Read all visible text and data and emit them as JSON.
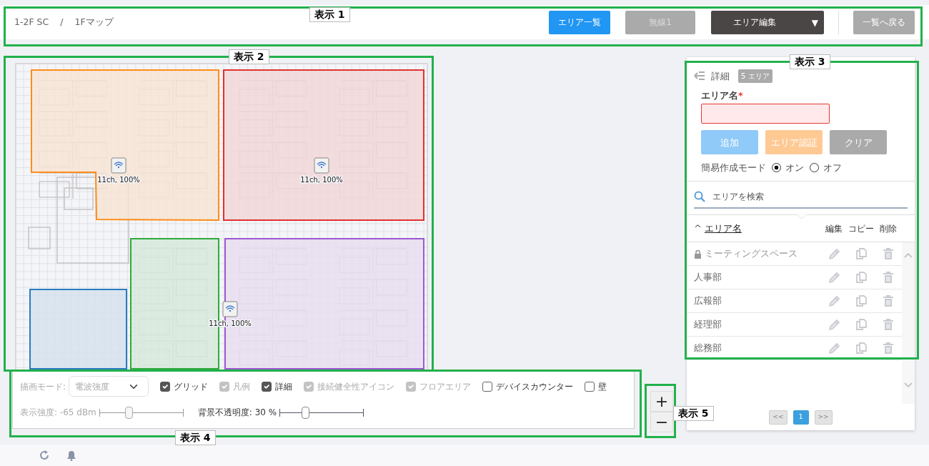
{
  "breadcrumb": [
    "1-2F SC",
    "1Fマップ"
  ],
  "breadcrumb_separator": "/",
  "toolbar": [
    {
      "label": "エリア一覧",
      "kind": "primary",
      "disabled": false
    },
    {
      "label": "無線1",
      "kind": "secondary",
      "disabled": true
    },
    {
      "label": "エリア編集",
      "kind": "dropdown",
      "caret": "▼",
      "disabled": false
    },
    {
      "label": "一覧へ戻る",
      "kind": "back",
      "disabled": false
    }
  ],
  "map": {
    "areas": [
      {
        "color": "#ff8c1a"
      },
      {
        "color": "#e03131"
      },
      {
        "color": "#2eaa3c"
      },
      {
        "color": "#9b59d0"
      },
      {
        "color": "#2a7bc0"
      }
    ],
    "access_points": [
      {
        "label": "11ch, 100%"
      },
      {
        "label": "11ch, 100%"
      },
      {
        "label": "11ch, 100%"
      }
    ]
  },
  "display_options": {
    "mode_label": "描画モード:",
    "mode_value": "電波強度",
    "mode_disabled": true,
    "checkboxes": [
      {
        "label": "グリッド",
        "checked": true,
        "disabled": false
      },
      {
        "label": "凡例",
        "checked": true,
        "disabled": true
      },
      {
        "label": "詳細",
        "checked": true,
        "disabled": false
      },
      {
        "label": "接続健全性アイコン",
        "checked": true,
        "disabled": true
      },
      {
        "label": "フロアエリア",
        "checked": true,
        "disabled": true
      },
      {
        "label": "デバイスカウンター",
        "checked": false,
        "disabled": false
      },
      {
        "label": "壁",
        "checked": false,
        "disabled": false
      }
    ],
    "sliders": [
      {
        "label": "表示強度: -65 dBm",
        "level": 0.35,
        "disabled": true
      },
      {
        "label": "背景不透明度: 30 %",
        "level": 0.3,
        "disabled": false
      }
    ]
  },
  "zoom": [
    "+",
    "−"
  ],
  "detail_panel": {
    "title": "詳細",
    "count_badge": "5 エリア",
    "name_label": "エリア名",
    "required_mark": "*",
    "name_invalid": true,
    "buttons": [
      {
        "label": "追加",
        "kind": "add"
      },
      {
        "label": "エリア認証",
        "kind": "auth"
      },
      {
        "label": "クリア",
        "kind": "clear"
      }
    ],
    "mode_label": "簡易作成モード",
    "mode_options": [
      {
        "label": "オン",
        "selected": true
      },
      {
        "label": "オフ",
        "selected": false
      }
    ],
    "search": {
      "placeholder": "エリアを検索"
    },
    "columns": {
      "sort_mark": "^",
      "name": "エリア名",
      "edit": "編集",
      "copy": "コピー",
      "delete": "削除"
    },
    "rows": [
      {
        "name": "ミーティングスペース",
        "locked": true
      },
      {
        "name": "人事部",
        "locked": false
      },
      {
        "name": "広報部",
        "locked": false
      },
      {
        "name": "経理部",
        "locked": false
      },
      {
        "name": "総務部",
        "locked": false
      }
    ],
    "pagination": {
      "prev": "<<",
      "pages": [
        {
          "label": "1",
          "selected": true
        }
      ],
      "next": ">>"
    }
  },
  "callouts": [
    {
      "label": "表示 1"
    },
    {
      "label": "表示 2"
    },
    {
      "label": "表示 3"
    },
    {
      "label": "表示 4"
    },
    {
      "label": "表示 5"
    }
  ]
}
